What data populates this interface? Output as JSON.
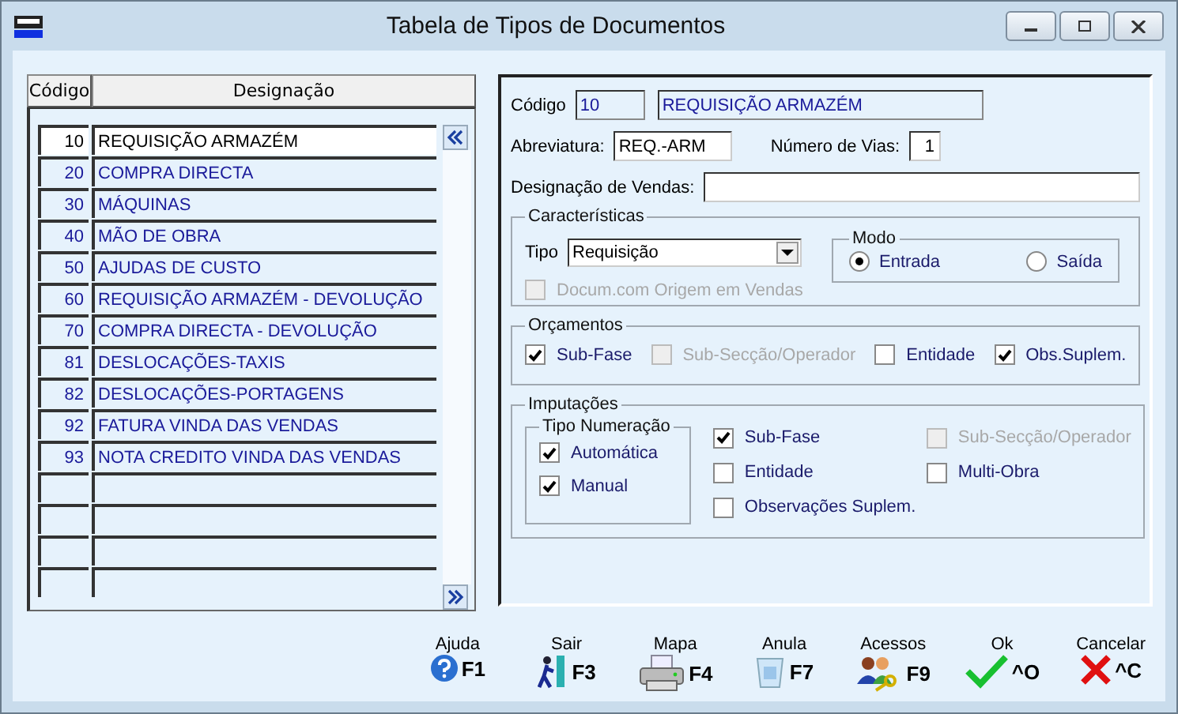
{
  "window": {
    "title": "Tabela de Tipos de Documentos"
  },
  "table": {
    "columns": [
      "Código",
      "Designação"
    ],
    "rows": [
      {
        "code": "10",
        "name": "REQUISIÇÃO ARMAZÉM",
        "selected": true
      },
      {
        "code": "20",
        "name": "COMPRA DIRECTA",
        "selected": false
      },
      {
        "code": "30",
        "name": "MÁQUINAS",
        "selected": false
      },
      {
        "code": "40",
        "name": "MÃO DE OBRA",
        "selected": false
      },
      {
        "code": "50",
        "name": "AJUDAS DE CUSTO",
        "selected": false
      },
      {
        "code": "60",
        "name": "REQUISIÇÃO ARMAZÉM - DEVOLUÇÃO",
        "selected": false
      },
      {
        "code": "70",
        "name": "COMPRA DIRECTA - DEVOLUÇÃO",
        "selected": false
      },
      {
        "code": "81",
        "name": "DESLOCAÇÕES-TAXIS",
        "selected": false
      },
      {
        "code": "82",
        "name": "DESLOCAÇÕES-PORTAGENS",
        "selected": false
      },
      {
        "code": "92",
        "name": "FATURA VINDA DAS VENDAS",
        "selected": false
      },
      {
        "code": "93",
        "name": "NOTA CREDITO VINDA DAS VENDAS",
        "selected": false
      }
    ]
  },
  "form": {
    "codigo_label": "Código",
    "codigo": "10",
    "designacao": "REQUISIÇÃO ARMAZÉM",
    "abreviatura_label": "Abreviatura:",
    "abreviatura": "REQ.-ARM",
    "vias_label": "Número de Vias:",
    "vias": "1",
    "vendas_label": "Designação de Vendas:"
  },
  "caracteristicas": {
    "title": "Características",
    "tipo_label": "Tipo",
    "tipo": "Requisição",
    "origem": {
      "label": "Docum.com Origem em Vendas",
      "checked": false,
      "disabled": true
    },
    "modo": {
      "title": "Modo",
      "options": [
        {
          "label": "Entrada",
          "selected": true
        },
        {
          "label": "Saída",
          "selected": false
        }
      ]
    }
  },
  "orcamentos": {
    "title": "Orçamentos",
    "checks": [
      {
        "label": "Sub-Fase",
        "checked": true,
        "disabled": false
      },
      {
        "label": "Sub-Secção/Operador",
        "checked": false,
        "disabled": true
      },
      {
        "label": "Entidade",
        "checked": false,
        "disabled": false
      },
      {
        "label": "Obs.Suplem.",
        "checked": true,
        "disabled": false
      }
    ]
  },
  "imputacoes": {
    "title": "Imputações",
    "numeracao": {
      "title": "Tipo Numeração",
      "checks": [
        {
          "label": "Automática",
          "checked": true,
          "disabled": false
        },
        {
          "label": "Manual",
          "checked": true,
          "disabled": false
        }
      ]
    },
    "checks": [
      {
        "label": "Sub-Fase",
        "checked": true,
        "disabled": false
      },
      {
        "label": "Entidade",
        "checked": false,
        "disabled": false
      },
      {
        "label": "Observações Suplem.",
        "checked": false,
        "disabled": false
      },
      {
        "label": "Sub-Secção/Operador",
        "checked": false,
        "disabled": true
      },
      {
        "label": "Multi-Obra",
        "checked": false,
        "disabled": false
      }
    ]
  },
  "toolbar": [
    {
      "label": "Ajuda",
      "key": "F1",
      "kind": "help"
    },
    {
      "label": "Sair",
      "key": "F3",
      "kind": "exit"
    },
    {
      "label": "Mapa",
      "key": "F4",
      "kind": "print"
    },
    {
      "label": "Anula",
      "key": "F7",
      "kind": "cancel"
    },
    {
      "label": "Acessos",
      "key": "F9",
      "kind": "access"
    },
    {
      "label": "Ok",
      "key": "^O",
      "kind": "ok"
    },
    {
      "label": "Cancelar",
      "key": "^C",
      "kind": "close"
    }
  ]
}
